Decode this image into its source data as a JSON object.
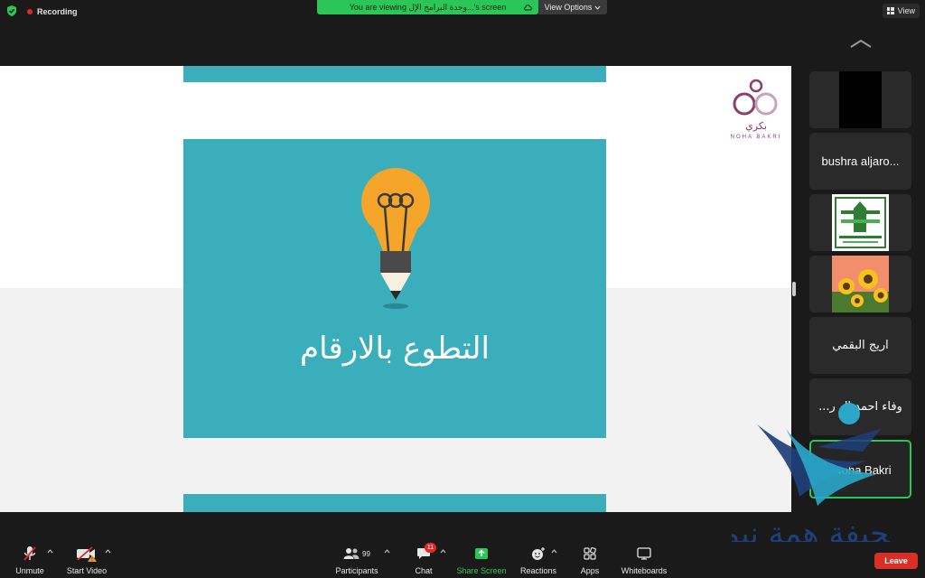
{
  "topbar": {
    "recording_label": "Recording",
    "viewing_banner": "You are viewing وحدة البرامج الإل...'s screen",
    "view_options_label": "View Options",
    "view_label": "View"
  },
  "slide": {
    "title": "التطوع بالارقام"
  },
  "logo": {
    "text": "بكري",
    "subtext": "NOHA BAKRI"
  },
  "participants": [
    {
      "name": "",
      "kind": "black-video"
    },
    {
      "name": "bushra aljaro..."
    },
    {
      "name": "",
      "kind": "image-green-logo"
    },
    {
      "name": "",
      "kind": "image-sunflowers"
    },
    {
      "name": "اريج البقمي",
      "rtl": true
    },
    {
      "name": "وفاء احمد ال ر...",
      "rtl": true
    },
    {
      "name": "Noha Bakri",
      "active": true
    }
  ],
  "toolbar": {
    "unmute_label": "Unmute",
    "start_video_label": "Start Video",
    "participants_label": "Participants",
    "participants_count": "99",
    "chat_label": "Chat",
    "chat_badge": "11",
    "share_screen_label": "Share Screen",
    "reactions_label": "Reactions",
    "apps_label": "Apps",
    "whiteboards_label": "Whiteboards",
    "leave_label": "Leave"
  },
  "watermark": {
    "text": "صحيفة همة نيوز"
  },
  "colors": {
    "slide_bg": "#3aaebb",
    "banner_green": "#2bc657",
    "leave_red": "#d93025",
    "logo_purple": "#8b3f6d"
  }
}
